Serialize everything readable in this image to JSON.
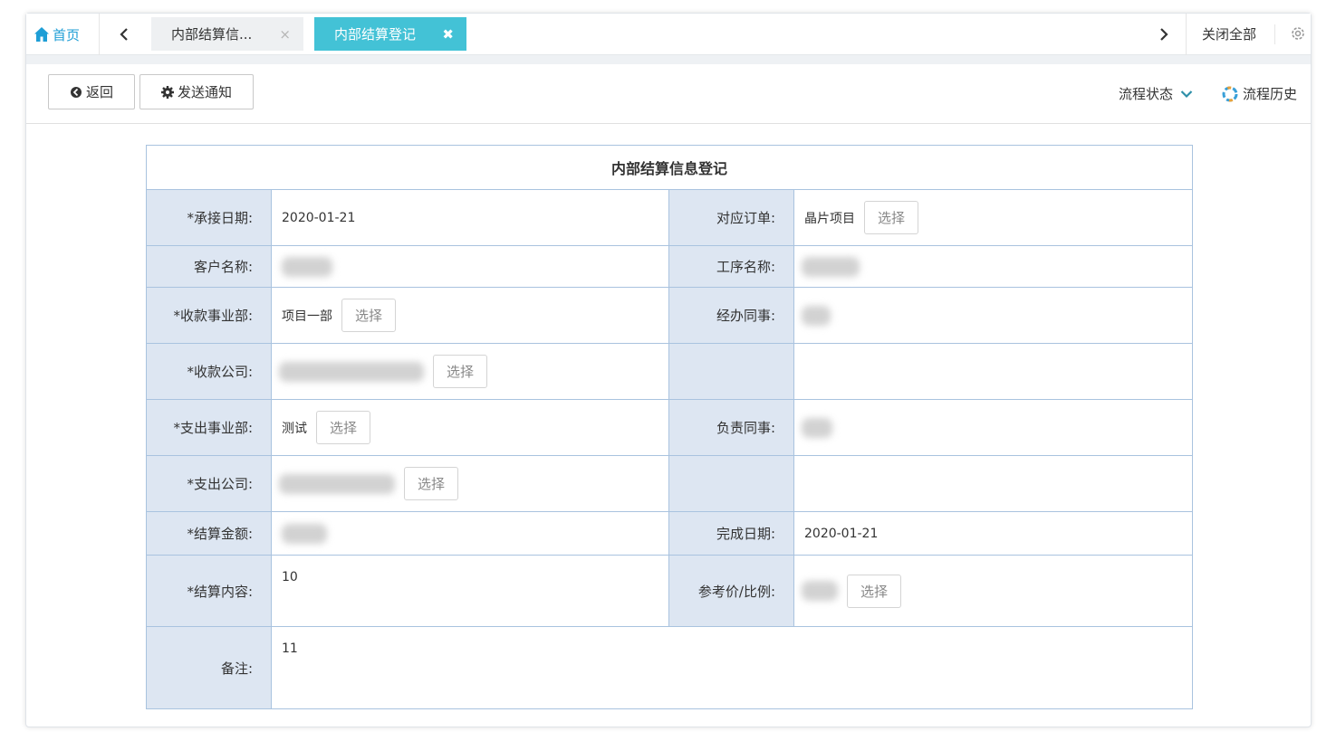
{
  "tabbar": {
    "home_label": "首页",
    "tabs": [
      {
        "label": "内部结算信...",
        "close": "×"
      },
      {
        "label": "内部结算登记",
        "close": "✖"
      }
    ],
    "close_all_label": "关闭全部"
  },
  "toolbar": {
    "back_label": "返回",
    "notify_label": "发送通知",
    "status_label": "流程状态",
    "history_label": "流程历史"
  },
  "form": {
    "title": "内部结算信息登记",
    "select_label": "选择",
    "fields": {
      "accept_date": {
        "label": "*承接日期:",
        "value": "2020-01-21"
      },
      "order": {
        "label": "对应订单:",
        "value": "晶片项目"
      },
      "customer": {
        "label": "客户名称:"
      },
      "process": {
        "label": "工序名称:"
      },
      "recv_dept": {
        "label": "*收款事业部:",
        "value": "项目一部"
      },
      "handler": {
        "label": "经办同事:"
      },
      "recv_company": {
        "label": "*收款公司:"
      },
      "pay_dept": {
        "label": "*支出事业部:",
        "value": "测试"
      },
      "owner": {
        "label": "负责同事:"
      },
      "pay_company": {
        "label": "*支出公司:"
      },
      "amount": {
        "label": "*结算金额:"
      },
      "finish_date": {
        "label": "完成日期:",
        "value": "2020-01-21"
      },
      "content": {
        "label": "*结算内容:",
        "value": "10"
      },
      "ref_price": {
        "label": "参考价/比例:"
      },
      "remark": {
        "label": "备注:",
        "value": "11"
      }
    }
  },
  "colors": {
    "accent": "#43c2d6",
    "home_link": "#1e9ed6",
    "label_bg": "#dde6f2",
    "border": "#a9c3df"
  }
}
